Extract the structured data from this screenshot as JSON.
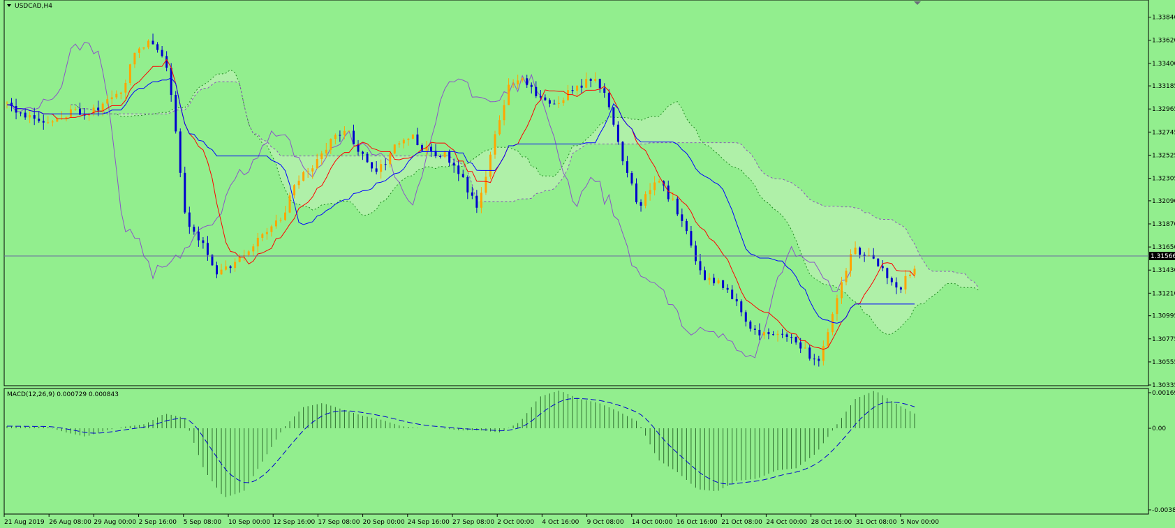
{
  "symbol_label": "USDCAD,H4",
  "indicator_label": "MACD(12,26,9) 0.000729 0.000843",
  "current_price_label": "1.31566",
  "colors": {
    "background": "#92ee8e",
    "bull_candle": "#ffa500",
    "bear_candle": "#0000cd",
    "tenkan": "#ff0000",
    "kijun": "#0000ff",
    "chikou": "#8b55c8",
    "senkou_a": "#228b22",
    "senkou_b": "#ffffff",
    "macd_histogram": "#2f6f2f",
    "macd_signal": "#0000cd"
  },
  "chart_data": {
    "type": "candlestick",
    "instrument": "USDCAD",
    "timeframe": "H4",
    "price_axis": {
      "ticks": [
        "1.33840",
        "1.33620",
        "1.33400",
        "1.33185",
        "1.32965",
        "1.32745",
        "1.32525",
        "1.32305",
        "1.32090",
        "1.31870",
        "1.31650",
        "1.31430",
        "1.31210",
        "1.30995",
        "1.30775",
        "1.30555",
        "1.30335"
      ],
      "range": [
        1.30335,
        1.3395
      ]
    },
    "macd_axis": {
      "ticks": [
        "0.001692",
        "0.00",
        "-0.00388"
      ],
      "range": [
        -0.00388,
        0.001692
      ]
    },
    "time_labels": [
      "21 Aug 2019",
      "26 Aug 08:00",
      "29 Aug 00:00",
      "2 Sep 16:00",
      "5 Sep 08:00",
      "10 Sep 00:00",
      "12 Sep 16:00",
      "17 Sep 08:00",
      "20 Sep 00:00",
      "24 Sep 16:00",
      "27 Sep 08:00",
      "2 Oct 00:00",
      "4 Oct 16:00",
      "9 Oct 08:00",
      "14 Oct 00:00",
      "16 Oct 16:00",
      "21 Oct 08:00",
      "24 Oct 00:00",
      "28 Oct 16:00",
      "31 Oct 08:00",
      "5 Nov 00:00"
    ],
    "current_price": 1.31566,
    "close_anchors": [
      1.33,
      1.3292,
      1.3288,
      1.3285,
      1.3296,
      1.3292,
      1.33,
      1.331,
      1.3355,
      1.3362,
      1.333,
      1.3195,
      1.317,
      1.314,
      1.3148,
      1.3165,
      1.318,
      1.3195,
      1.323,
      1.3245,
      1.3268,
      1.3276,
      1.325,
      1.3238,
      1.3265,
      1.327,
      1.3255,
      1.3252,
      1.3232,
      1.32,
      1.3265,
      1.3318,
      1.3325,
      1.3302,
      1.3305,
      1.3315,
      1.3325,
      1.3312,
      1.3242,
      1.3205,
      1.323,
      1.321,
      1.3175,
      1.3135,
      1.3132,
      1.311,
      1.3085,
      1.3082,
      1.308,
      1.3068,
      1.3055,
      1.31,
      1.316,
      1.316,
      1.3145,
      1.3125,
      1.3148
    ],
    "macd_anchors": [
      0.0001,
      8e-05,
      8e-05,
      -0.0002,
      -0.0004,
      -0.0001,
      8e-05,
      0.0002,
      0.0007,
      0.0005,
      -0.002,
      -0.0033,
      -0.003,
      -0.0015,
      0.0,
      0.001,
      0.0012,
      0.0009,
      0.0006,
      0.0004,
      0.0001,
      0.0,
      0.0,
      -0.0001,
      -0.0001,
      -0.0002,
      0.0003,
      0.0015,
      0.0018,
      0.0014,
      0.0012,
      0.0008,
      0.0003,
      -0.0015,
      -0.0021,
      -0.0029,
      -0.003,
      -0.0025,
      -0.0024,
      -0.002,
      -0.0019,
      -0.0012,
      0.0001,
      0.0014,
      0.0018,
      0.0012,
      0.0007
    ]
  }
}
